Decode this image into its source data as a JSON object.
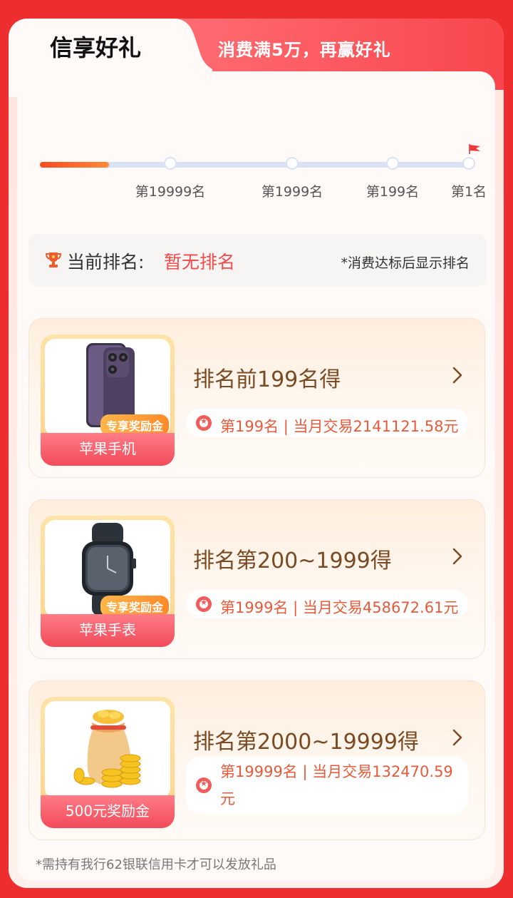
{
  "tabs": {
    "active": "信享好礼",
    "other": "消费满5万，再赢好礼"
  },
  "progress": {
    "fill_fraction": 0.16,
    "milestones": [
      "第19999名",
      "第1999名",
      "第199名",
      "第1名"
    ]
  },
  "rank": {
    "label": "当前排名:",
    "value": "暂无排名",
    "note": "*消费达标后显示排名"
  },
  "rewards": [
    {
      "title": "排名前199名得",
      "info": "第199名 | 当月交易2141121.58元",
      "thumb_label": "苹果手机",
      "badge": "专享奖励金"
    },
    {
      "title": "排名第200~1999得",
      "info": "第1999名 | 当月交易458672.61元",
      "thumb_label": "苹果手表",
      "badge": "专享奖励金"
    },
    {
      "title": "排名第2000~19999得",
      "info": "第19999名 | 当月交易132470.59元",
      "thumb_label": "500元奖励金",
      "badge": ""
    }
  ],
  "footnote": "*需持有我行62银联信用卡才可以发放礼品",
  "colors": {
    "page_bg": "#ee2e2e",
    "accent_red": "#f04a4a",
    "title_brown": "#7a4a22"
  }
}
